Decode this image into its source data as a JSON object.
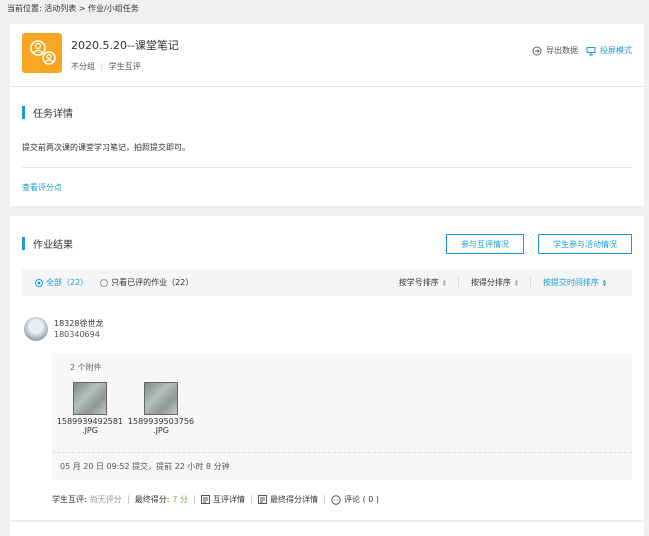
{
  "breadcrumb": "当前位置: 活动列表 > 作业/小组任务",
  "task": {
    "title": "2020.5.20--课堂笔记",
    "group_mode": "不分组",
    "separator": "|",
    "review_mode": "学生互评",
    "export_label": "导出数据",
    "projection_label": "投屏模式",
    "icon_color": "#f6a623"
  },
  "details": {
    "heading": "任务详情",
    "description": "提交前两次课的课堂学习笔记，拍照提交即可。",
    "rubric_link": "查看评分点"
  },
  "results": {
    "heading": "作业结果",
    "btn_peer": "参与互评情况",
    "btn_participation": "学生参与活动情况",
    "filter_all": "全部（22）",
    "filter_reviewed": "只看已评的作业（22）",
    "sort_student_no": "按学号排序",
    "sort_score": "按得分排序",
    "sort_time": "按提交时间排序"
  },
  "submission": {
    "student_name": "18328徐世龙",
    "student_id": "180340694",
    "attachment_count": "2 个附件",
    "files": [
      {
        "name": "1589939492581",
        "ext": ".JPG"
      },
      {
        "name": "1589939503756",
        "ext": ".JPG"
      }
    ],
    "submit_time": "05 月 20 日 09:52 提交，提前 22 小时 8 分钟",
    "peer_label": "学生互评:",
    "peer_value": "尚无评分",
    "final_label": "最终得分:",
    "final_value": "7 分",
    "peer_detail": "互评详情",
    "final_detail": "最终得分详情",
    "comment": "评论 ( 0 )"
  },
  "colors": {
    "accent": "#1a9bd7",
    "score_green": "#7cb342"
  }
}
